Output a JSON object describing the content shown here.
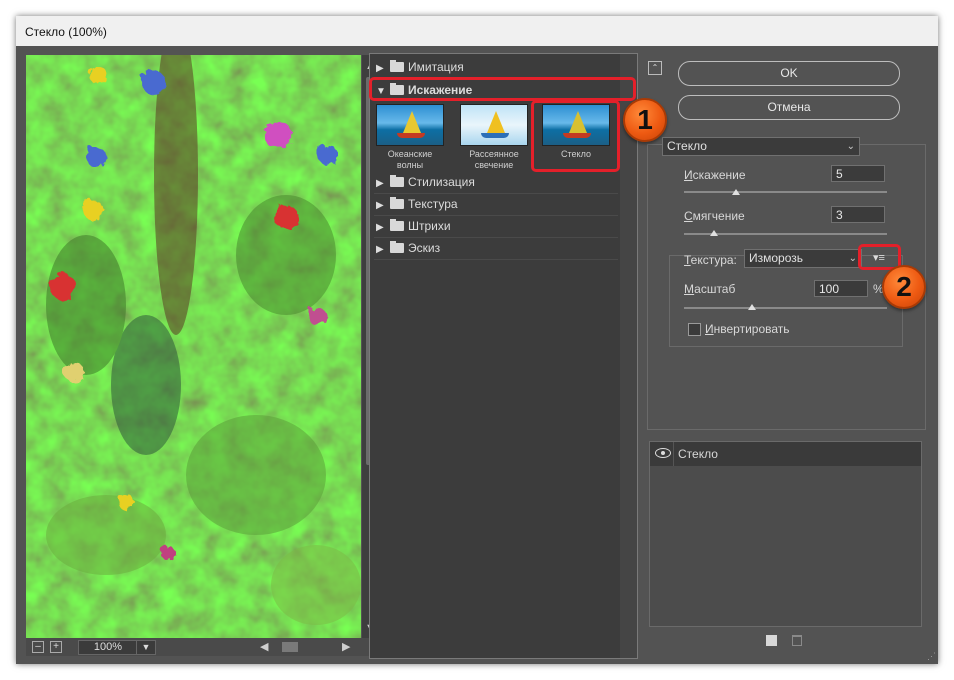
{
  "window": {
    "title": "Стекло (100%)"
  },
  "preview": {
    "zoom": "100%"
  },
  "filters": {
    "categories": [
      {
        "label": "Имитация",
        "expanded": false
      },
      {
        "label": "Искажение",
        "expanded": true
      },
      {
        "label": "Стилизация",
        "expanded": false
      },
      {
        "label": "Текстура",
        "expanded": false
      },
      {
        "label": "Штрихи",
        "expanded": false
      },
      {
        "label": "Эскиз",
        "expanded": false
      }
    ],
    "distortion_items": [
      {
        "line1": "Океанские волны",
        "line2": ""
      },
      {
        "line1": "Рассеянное",
        "line2": "свечение"
      },
      {
        "line1": "Стекло",
        "line2": "",
        "selected": true
      }
    ]
  },
  "buttons": {
    "ok": "OK",
    "cancel": "Отмена"
  },
  "settings": {
    "filter_select": "Стекло",
    "distortion": {
      "label": "Искажение",
      "accel": "И",
      "rest": "скажение",
      "value": "5",
      "level": 0.25
    },
    "smoothness": {
      "label": "Смягчение",
      "accel": "С",
      "rest": "мягчение",
      "value": "3",
      "level": 0.2
    },
    "texture": {
      "label": "Текстура:",
      "accel": "Т",
      "rest": "екстура:",
      "value": "Изморозь"
    },
    "scale": {
      "label": "Масштаб",
      "accel": "М",
      "rest": "асштаб",
      "value": "100",
      "unit": "%",
      "level": 0.35
    },
    "invert": {
      "label": "Инвертировать",
      "accel": "И",
      "rest": "нвертировать",
      "checked": false
    }
  },
  "layers": [
    {
      "name": "Стекло",
      "visible": true
    }
  ],
  "annotations": [
    {
      "label": "1",
      "color": "#ee5a12"
    },
    {
      "label": "2",
      "color": "#ee5a12"
    }
  ]
}
